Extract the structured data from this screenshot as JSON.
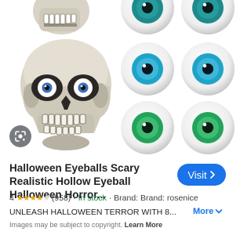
{
  "result": {
    "title": "Halloween Eyeballs Scary Realistic Hollow Eyeball Halloween Horror...",
    "visit_label": "Visit",
    "rating_value": "4",
    "rating_count": "(958)",
    "stock": "In stock",
    "brand": "Brand: Brand: rosenice",
    "description": "UNLEASH HALLOWEEN TERROR WITH 8...",
    "more_label": "More",
    "disclaimer": "Images may be subject to copyright.",
    "learn_more_label": "Learn More"
  },
  "rating": {
    "stars_filled": 4,
    "stars_total": 5
  },
  "icons": {
    "lens": "google-lens-icon",
    "visit_arrow": "chevron-right-icon",
    "more_chevron": "chevron-down-icon"
  },
  "colors": {
    "accent": "#1a73e8",
    "stars": "#e8a30c",
    "stock": "#188038",
    "eye_teal": "#1f8a8c",
    "eye_blue": "#1fa3c8",
    "eye_green": "#22a35a"
  }
}
